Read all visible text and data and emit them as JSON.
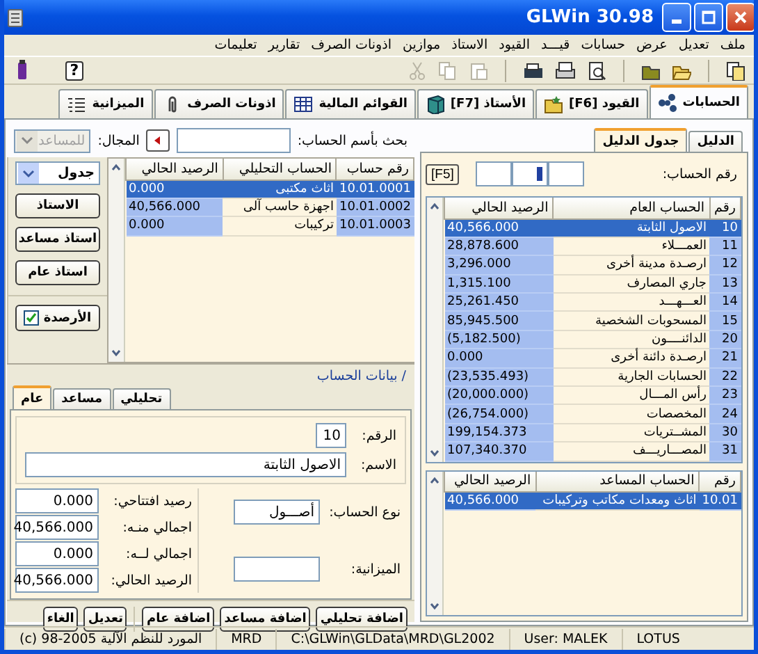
{
  "window": {
    "title": "GLWin 30.98"
  },
  "menu": [
    "ملف",
    "تعديل",
    "عرض",
    "حسابات",
    "قيـــد",
    "القيود",
    "الاستاذ",
    "موازين",
    "اذونات الصرف",
    "تقارير",
    "تعليمات"
  ],
  "toolbar": {
    "help": "?",
    "clipboard_disabled": true
  },
  "tabs": [
    {
      "label": "الحسابات",
      "selected": true
    },
    {
      "label": "القيود [F6]",
      "selected": false
    },
    {
      "label": "الأستاذ [F7]",
      "selected": false
    },
    {
      "label": "القوائم المالية",
      "selected": false
    },
    {
      "label": "اذونات الصرف",
      "selected": false
    },
    {
      "label": "الميزانية",
      "selected": false
    }
  ],
  "search": {
    "label": "بحث بأسم الحساب:",
    "range_label": "المجال:",
    "range_value": "للمساعد",
    "range_disabled": true
  },
  "analytic_table": {
    "columns": [
      "رقم حساب",
      "الحساب التحليلي",
      "الرصيد الحالي"
    ],
    "rows": [
      {
        "number": "10.01.0001",
        "name": "اثاث مكتبى",
        "balance": "0.000",
        "selected": true
      },
      {
        "number": "10.01.0002",
        "name": "اجهزة حاسب آلى",
        "balance": "40,566.000",
        "selected": false
      },
      {
        "number": "10.01.0003",
        "name": "تركيبات",
        "balance": "0.000",
        "selected": false
      }
    ]
  },
  "view_select": {
    "value": "جدول"
  },
  "ledger_buttons": [
    "الاستاذ",
    "استاذ مساعد",
    "استاذ عام"
  ],
  "balances_toggle": {
    "label": "الأرصدة",
    "checked": true
  },
  "section_title": "/ بيانات الحساب",
  "detail_tabs": [
    {
      "label": "تحليلي",
      "selected": false
    },
    {
      "label": "مساعد",
      "selected": false
    },
    {
      "label": "عام",
      "selected": true
    }
  ],
  "form": {
    "number_label": "الرقم:",
    "number": "10",
    "name_label": "الاسم:",
    "name": "الاصول الثابتة",
    "type_label": "نوع الحساب:",
    "type": "أصـــول",
    "budget_label": "الميزانية:",
    "totals": [
      {
        "label": "رصيد افتتاحي:",
        "value": "0.000"
      },
      {
        "label": "اجمالي منـه:",
        "value": "40,566.000"
      },
      {
        "label": "اجمالي لــه:",
        "value": "0.000"
      },
      {
        "label": "الرصيد الحالي:",
        "value": "40,566.000"
      }
    ]
  },
  "actions": [
    "اضافة تحليلي",
    "اضافة مساعد",
    "اضافة عام",
    "تعديل",
    "الغاء"
  ],
  "chart_tabs": [
    {
      "label": "الدليل",
      "selected": false
    },
    {
      "label": "جدول الدليل",
      "selected": true
    }
  ],
  "account_lookup": {
    "label": "رقم الحساب:",
    "key": "[F5]"
  },
  "general_table": {
    "columns": [
      "رقم",
      "الحساب العام",
      "الرصيد الحالي"
    ],
    "rows": [
      {
        "number": "10",
        "name": "الاصول الثابتة",
        "balance": "40,566.000",
        "selected": true
      },
      {
        "number": "11",
        "name": "العمـــلاء",
        "balance": "28,878.600",
        "selected": false
      },
      {
        "number": "12",
        "name": "ارصـدة مدينة أخرى",
        "balance": "3,296.000",
        "selected": false
      },
      {
        "number": "13",
        "name": "جاري المصارف",
        "balance": "1,315.100",
        "selected": false
      },
      {
        "number": "14",
        "name": "العـــهـــد",
        "balance": "25,261.450",
        "selected": false
      },
      {
        "number": "15",
        "name": "المسحوبات الشخصية",
        "balance": "85,945.500",
        "selected": false
      },
      {
        "number": "20",
        "name": "الدائنــــون",
        "balance": "(5,182.500)",
        "selected": false
      },
      {
        "number": "21",
        "name": "ارصـدة دائنة أخرى",
        "balance": "0.000",
        "selected": false
      },
      {
        "number": "22",
        "name": "الحسابات الجارية",
        "balance": "(23,535.493)",
        "selected": false
      },
      {
        "number": "23",
        "name": "رأس المـــال",
        "balance": "(20,000.000)",
        "selected": false
      },
      {
        "number": "24",
        "name": "المخصصات",
        "balance": "(26,754.000)",
        "selected": false
      },
      {
        "number": "30",
        "name": "المشــتريات",
        "balance": "199,154.373",
        "selected": false
      },
      {
        "number": "31",
        "name": "المصـــاريـــف",
        "balance": "107,340.370",
        "selected": false
      }
    ]
  },
  "sub_table": {
    "columns": [
      "رقم",
      "الحساب المساعد",
      "الرصيد الحالي"
    ],
    "rows": [
      {
        "number": "10.01",
        "name": "اثاث ومعدات مكاتب وتركيبات",
        "balance": "40,566.000",
        "selected": true
      }
    ]
  },
  "status_bar": [
    "LOTUS",
    "User: MALEK",
    "C:\\GLWin\\GLData\\MRD\\GL2002",
    "MRD",
    "(c) 98-2005 المورد للنظم الآلية"
  ]
}
